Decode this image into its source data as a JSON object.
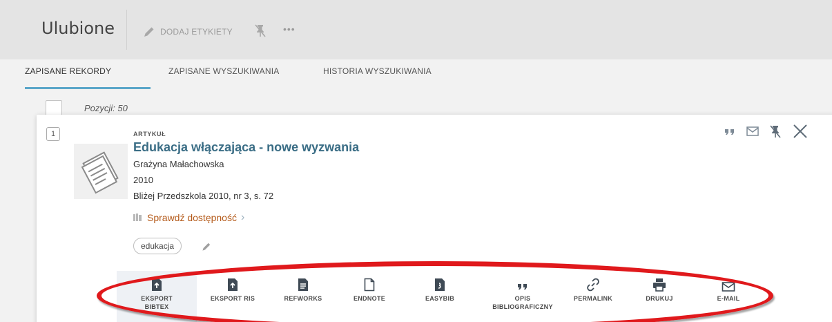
{
  "header": {
    "title": "Ulubione",
    "add_labels": "DODAJ ETYKIETY",
    "more": "•••"
  },
  "tabs": [
    {
      "label": "ZAPISANE REKORDY",
      "active": true
    },
    {
      "label": "ZAPISANE WYSZUKIWANIA",
      "active": false
    },
    {
      "label": "HISTORIA WYSZUKIWANIA",
      "active": false
    }
  ],
  "list": {
    "count_label": "Pozycji: 50"
  },
  "record": {
    "number": "1",
    "type": "ARTYKUŁ",
    "title": "Edukacja włączająca - nowe wyzwania",
    "author": "Grażyna Małachowska",
    "year": "2010",
    "source": "Bliżej Przedszkola 2010, nr 3, s. 72",
    "availability": "Sprawdź dostępność",
    "availability_arrow": "›",
    "tag": "edukacja"
  },
  "actions": [
    {
      "label": "EKSPORT BIBTEX",
      "icon": "export-bibtex-icon"
    },
    {
      "label": "EKSPORT RIS",
      "icon": "export-ris-icon"
    },
    {
      "label": "REFWORKS",
      "icon": "refworks-icon"
    },
    {
      "label": "ENDNOTE",
      "icon": "endnote-icon"
    },
    {
      "label": "EASYBIB",
      "icon": "easybib-icon"
    },
    {
      "label": "OPIS BIBLIOGRAFICZNY",
      "icon": "citation-icon"
    },
    {
      "label": "PERMALINK",
      "icon": "link-icon"
    },
    {
      "label": "DRUKUJ",
      "icon": "print-icon"
    },
    {
      "label": "E-MAIL",
      "icon": "mail-icon"
    }
  ],
  "colors": {
    "accent": "#5aa6c9",
    "title": "#3a6d85",
    "availability": "#b45a1a",
    "highlight": "#e0191c"
  }
}
